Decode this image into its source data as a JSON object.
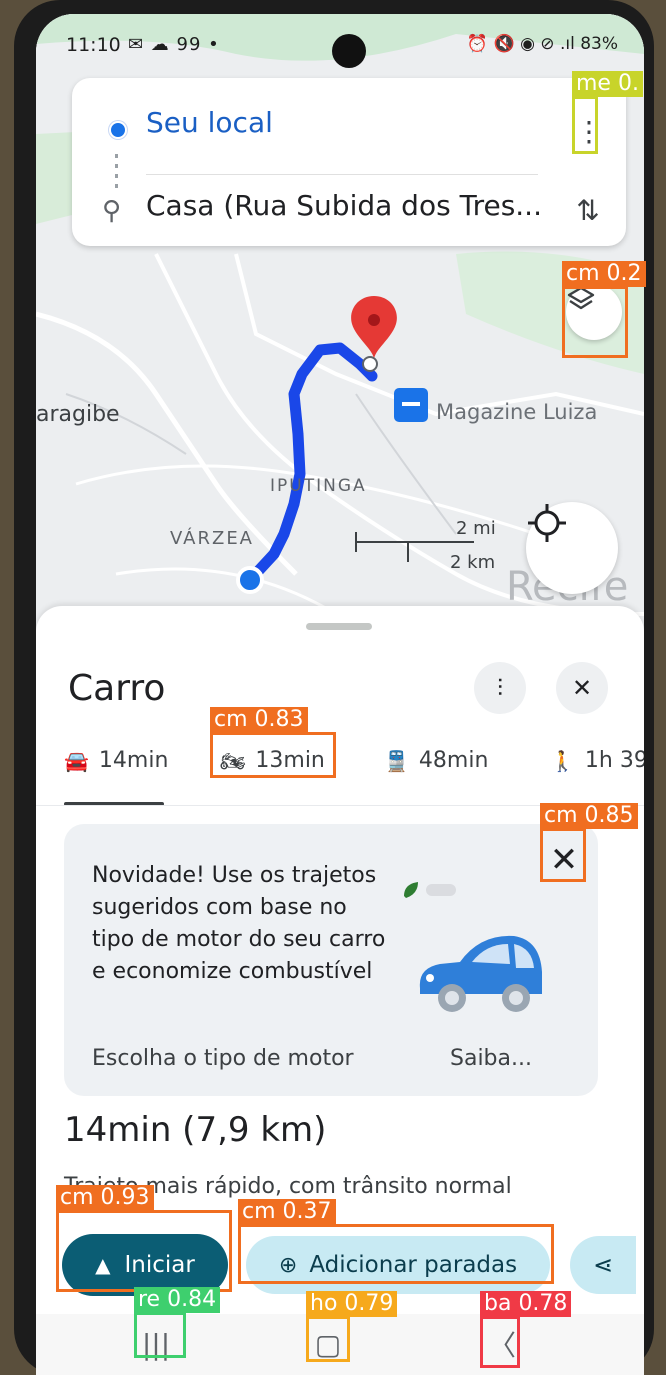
{
  "status_bar": {
    "time": "11:10",
    "left_icons": "✉ ☁ 99 •",
    "right_text": "⏰ 🔇 ◉ ⊘ .ıl 83%"
  },
  "route": {
    "origin": "Seu local",
    "destination": "Casa (Rua Subida dos Tres..."
  },
  "map": {
    "labels": {
      "araragibe": "aragibe",
      "store": "Magazine Luiza",
      "iputinga": "IPUTINGA",
      "varzea": "VÁRZEA",
      "recife": "Recife"
    },
    "scale_mi": "2 mi",
    "scale_km": "2 km"
  },
  "sheet": {
    "title": "Carro",
    "modes": [
      {
        "icon": "car-icon",
        "label": "14min"
      },
      {
        "icon": "motorcycle-icon",
        "label": "13min"
      },
      {
        "icon": "transit-icon",
        "label": "48min"
      },
      {
        "icon": "walk-icon",
        "label": "1h 39"
      }
    ],
    "promo": {
      "text": "Novidade! Use os trajetos sugeridos com base no tipo de motor do seu carro e economize combustível",
      "link_choose": "Escolha o tipo de motor",
      "link_more": "Saiba..."
    },
    "summary_time": "14min (7,9 km)",
    "summary_desc": "Trajeto mais rápido, com trânsito normal",
    "start_label": "Iniciar",
    "add_stops_label": "Adicionar paradas"
  },
  "detections": [
    {
      "label": "me 0.",
      "color": "#c8d42a"
    },
    {
      "label": "cm 0.2",
      "color": "#f06e20"
    },
    {
      "label": "cm 0.83",
      "color": "#f06e20"
    },
    {
      "label": "cm 0.85",
      "color": "#f06e20"
    },
    {
      "label": "cm 0.93",
      "color": "#f06e20"
    },
    {
      "label": "cm 0.37",
      "color": "#f06e20"
    },
    {
      "label": "re 0.84",
      "color": "#3ecf6e"
    },
    {
      "label": "ho 0.79",
      "color": "#f6a91c"
    },
    {
      "label": "ba 0.78",
      "color": "#f03a46"
    }
  ],
  "colors": {
    "accent": "#1a73e8",
    "route": "#1a47e8",
    "start_button": "#0b5d74",
    "secondary_button": "#c8eaf3"
  }
}
